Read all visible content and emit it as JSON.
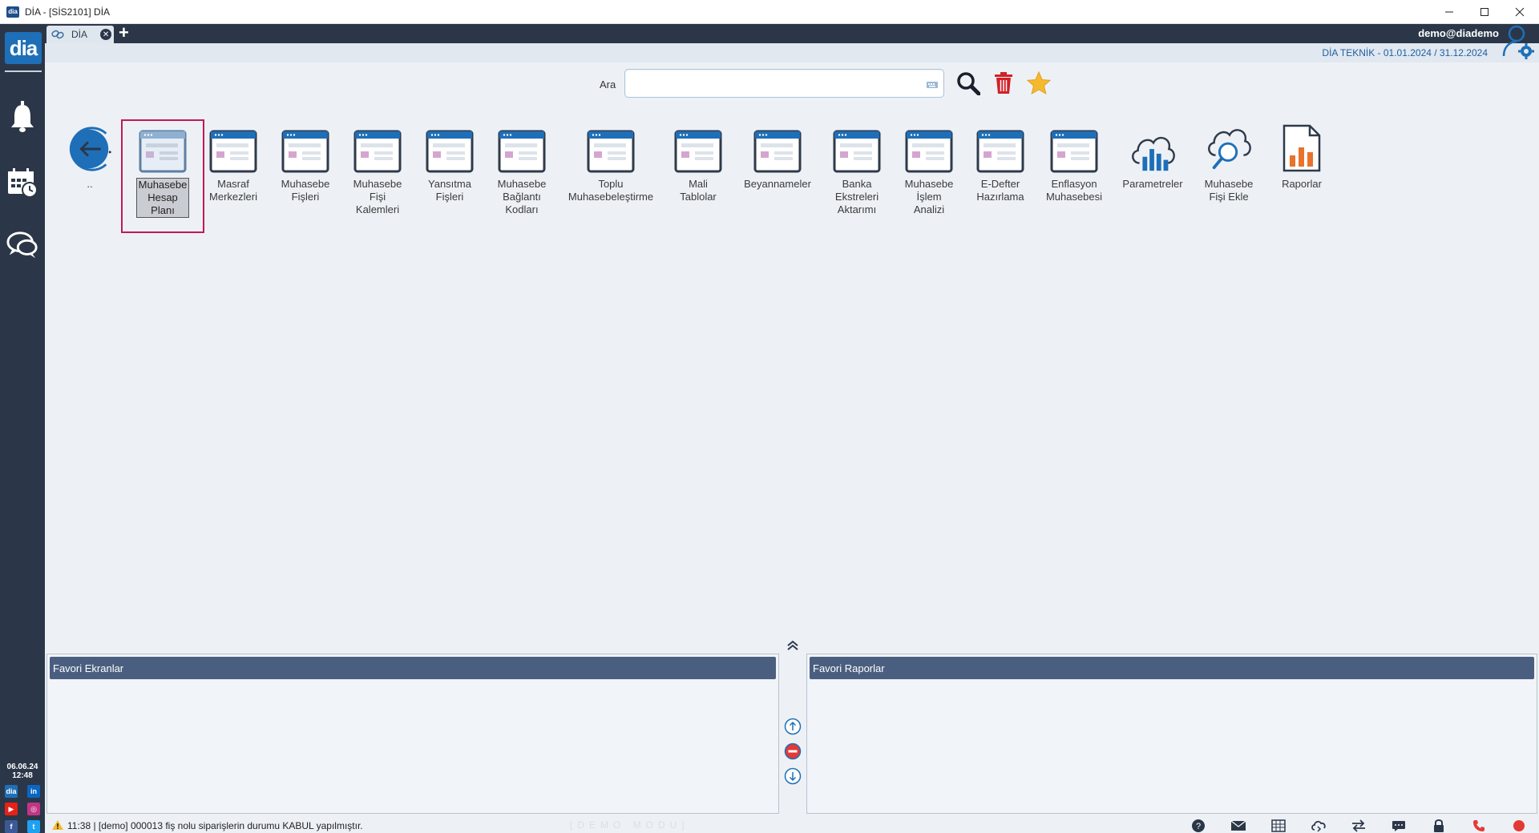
{
  "window": {
    "title": "DİA - [SİS2101] DİA",
    "app_icon_text": "dia",
    "controls": [
      "minimize-icon",
      "maximize-icon",
      "close-icon"
    ]
  },
  "sidebar": {
    "logo": "dia",
    "icons": [
      "bell-icon",
      "calendar-clock-icon",
      "chat-icon"
    ],
    "date": "06.06.24",
    "time": "12:48",
    "social": [
      "dia",
      "in",
      "▶",
      "◎",
      "f",
      "t"
    ]
  },
  "tabs": [
    {
      "label": "DİA",
      "icon": "link-icon"
    }
  ],
  "header": {
    "user_email": "demo@diademo",
    "company_period": "DİA TEKNİK -  01.01.2024 / 31.12.2024"
  },
  "search": {
    "label": "Ara",
    "value": "",
    "placeholder": ""
  },
  "back": {
    "label": ".."
  },
  "modules": [
    {
      "label1": "Muhasebe",
      "label2": "Hesap",
      "label3": "Planı",
      "icon": "window-form-icon",
      "selected": true
    },
    {
      "label1": "Masraf",
      "label2": "Merkezleri",
      "label3": "",
      "icon": "window-form-icon"
    },
    {
      "label1": "Muhasebe",
      "label2": "Fişleri",
      "label3": "",
      "icon": "window-form-icon"
    },
    {
      "label1": "Muhasebe",
      "label2": "Fişi",
      "label3": "Kalemleri",
      "icon": "window-form-icon"
    },
    {
      "label1": "Yansıtma",
      "label2": "Fişleri",
      "label3": "",
      "icon": "window-form-icon"
    },
    {
      "label1": "Muhasebe",
      "label2": "Bağlantı",
      "label3": "Kodları",
      "icon": "window-form-icon"
    },
    {
      "label1": "Toplu",
      "label2": "Muhasebeleştirme",
      "label3": "",
      "icon": "window-form-icon"
    },
    {
      "label1": "Mali",
      "label2": "Tablolar",
      "label3": "",
      "icon": "window-form-icon"
    },
    {
      "label1": "Beyannameler",
      "label2": "",
      "label3": "",
      "icon": "window-form-icon"
    },
    {
      "label1": "Banka",
      "label2": "Ekstreleri",
      "label3": "Aktarımı",
      "icon": "window-form-icon"
    },
    {
      "label1": "Muhasebe",
      "label2": "İşlem",
      "label3": "Analizi",
      "icon": "window-form-icon"
    },
    {
      "label1": "E-Defter",
      "label2": "Hazırlama",
      "label3": "",
      "icon": "window-form-icon"
    },
    {
      "label1": "Enflasyon",
      "label2": "Muhasebesi",
      "label3": "",
      "icon": "window-form-icon"
    },
    {
      "label1": "Parametreler",
      "label2": "",
      "label3": "",
      "icon": "cloud-chart-icon"
    },
    {
      "label1": "Muhasebe",
      "label2": "Fişi Ekle",
      "label3": "",
      "icon": "cloud-search-icon"
    },
    {
      "label1": "Raporlar",
      "label2": "",
      "label3": "",
      "icon": "report-doc-icon"
    }
  ],
  "panels": {
    "favorites_screens": "Favori Ekranlar",
    "favorites_reports": "Favori Raporlar"
  },
  "status": {
    "message": "11:38 | [demo] 000013 fiş nolu siparişlerin durumu KABUL yapılmıştır.",
    "demo_mode": "[DEMO MODU]"
  },
  "colors": {
    "sidebar": "#2b3748",
    "accent_blue": "#1e6fb8",
    "panel_header": "#4a5f80",
    "selection": "#c2185b"
  }
}
